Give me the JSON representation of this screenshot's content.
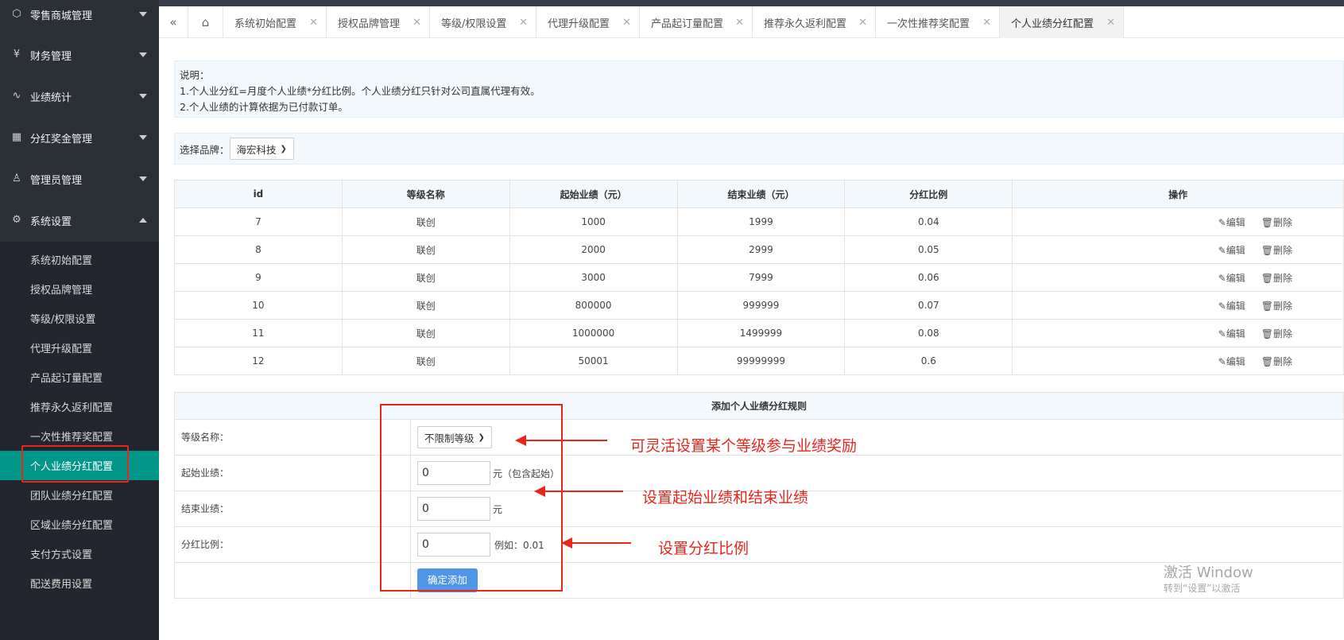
{
  "sidebar": {
    "groups": [
      {
        "label": "零售商城管理",
        "icon": "cube-icon"
      },
      {
        "label": "财务管理",
        "icon": "yen-icon"
      },
      {
        "label": "业绩统计",
        "icon": "pulse-icon"
      },
      {
        "label": "分红奖金管理",
        "icon": "grid-icon"
      },
      {
        "label": "管理员管理",
        "icon": "user-icon"
      },
      {
        "label": "系统设置",
        "icon": "gear-icon"
      }
    ],
    "sub_items": [
      "系统初始配置",
      "授权品牌管理",
      "等级/权限设置",
      "代理升级配置",
      "产品起订量配置",
      "推荐永久返利配置",
      "一次性推荐奖配置",
      "个人业绩分红配置",
      "团队业绩分红配置",
      "区域业绩分红配置",
      "支付方式设置",
      "配送费用设置"
    ]
  },
  "tabs": [
    {
      "label": "系统初始配置"
    },
    {
      "label": "授权品牌管理"
    },
    {
      "label": "等级/权限设置"
    },
    {
      "label": "代理升级配置"
    },
    {
      "label": "产品起订量配置"
    },
    {
      "label": "推荐永久返利配置"
    },
    {
      "label": "一次性推荐奖配置"
    },
    {
      "label": "个人业绩分红配置"
    }
  ],
  "notice": {
    "title": "说明：",
    "line1": "1.个人业分红=月度个人业绩*分红比例。个人业绩分红只针对公司直属代理有效。",
    "line2": "2.个人业绩的计算依据为已付款订单。"
  },
  "brand": {
    "label": "选择品牌：",
    "value": "海宏科技"
  },
  "table": {
    "headers": [
      "id",
      "等级名称",
      "起始业绩（元）",
      "结束业绩（元）",
      "分红比例",
      "操作"
    ],
    "edit_label": "编辑",
    "delete_label": "删除",
    "rows": [
      [
        "7",
        "联创",
        "1000",
        "1999",
        "0.04"
      ],
      [
        "8",
        "联创",
        "2000",
        "2999",
        "0.05"
      ],
      [
        "9",
        "联创",
        "3000",
        "7999",
        "0.06"
      ],
      [
        "10",
        "联创",
        "800000",
        "999999",
        "0.07"
      ],
      [
        "11",
        "联创",
        "1000000",
        "1499999",
        "0.08"
      ],
      [
        "12",
        "联创",
        "50001",
        "99999999",
        "0.6"
      ]
    ]
  },
  "form": {
    "title": "添加个人业绩分红规则",
    "level_label": "等级名称：",
    "level_value": "不限制等级",
    "start_label": "起始业绩：",
    "start_value": "0",
    "start_unit": "元（包含起始）",
    "end_label": "结束业绩：",
    "end_value": "0",
    "end_unit": "元",
    "ratio_label": "分红比例：",
    "ratio_value": "0",
    "ratio_hint": "例如：0.01",
    "submit_label": "确定添加"
  },
  "annotations": {
    "a1": "可灵活设置某个等级参与业绩奖励",
    "a2": "设置起始业绩和结束业绩",
    "a3": "设置分红比例"
  },
  "watermark": {
    "line1": "激活 Window",
    "line2": "转到“设置”以激活"
  },
  "colors": {
    "sidebar": "#2b2f36",
    "active": "#009688",
    "accent_red": "#e8261c",
    "button": "#4f95e8"
  }
}
